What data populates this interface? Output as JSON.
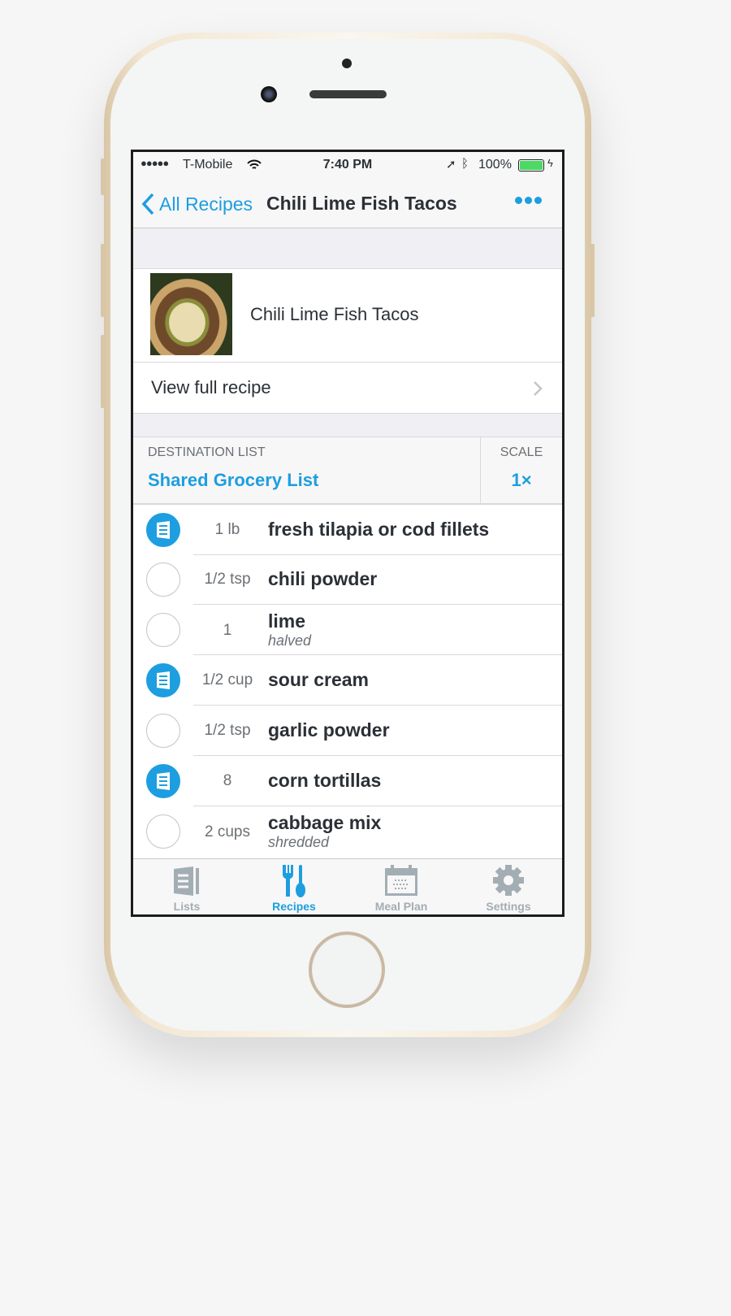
{
  "status_bar": {
    "carrier": "T-Mobile",
    "time": "7:40 PM",
    "battery": "100%",
    "battery_level": 1.0,
    "battery_color": "#4cd964"
  },
  "nav": {
    "back_label": "All Recipes",
    "title": "Chili Lime Fish Tacos",
    "more_icon": "ellipsis-icon"
  },
  "recipe": {
    "name": "Chili Lime Fish Tacos",
    "view_full": "View full recipe"
  },
  "destination": {
    "label": "DESTINATION LIST",
    "value": "Shared Grocery List",
    "scale_label": "SCALE",
    "scale_value": "1×"
  },
  "ingredients": [
    {
      "qty": "1 lb",
      "name": "fresh tilapia or cod fillets",
      "note": "",
      "checked": true
    },
    {
      "qty": "1/2 tsp",
      "name": "chili powder",
      "note": "",
      "checked": false
    },
    {
      "qty": "1",
      "name": "lime",
      "note": "halved",
      "checked": false
    },
    {
      "qty": "1/2 cup",
      "name": "sour cream",
      "note": "",
      "checked": true
    },
    {
      "qty": "1/2 tsp",
      "name": "garlic powder",
      "note": "",
      "checked": false
    },
    {
      "qty": "8",
      "name": "corn tortillas",
      "note": "",
      "checked": true
    },
    {
      "qty": "2 cups",
      "name": "cabbage mix",
      "note": "shredded",
      "checked": false
    }
  ],
  "tabs": [
    {
      "label": "Lists",
      "icon": "list-icon",
      "active": false
    },
    {
      "label": "Recipes",
      "icon": "fork-spoon-icon",
      "active": true
    },
    {
      "label": "Meal Plan",
      "icon": "calendar-icon",
      "active": false
    },
    {
      "label": "Settings",
      "icon": "gear-icon",
      "active": false
    }
  ],
  "colors": {
    "accent": "#1d9ee0",
    "inactive": "#a3adb4",
    "text": "#2b3036"
  }
}
